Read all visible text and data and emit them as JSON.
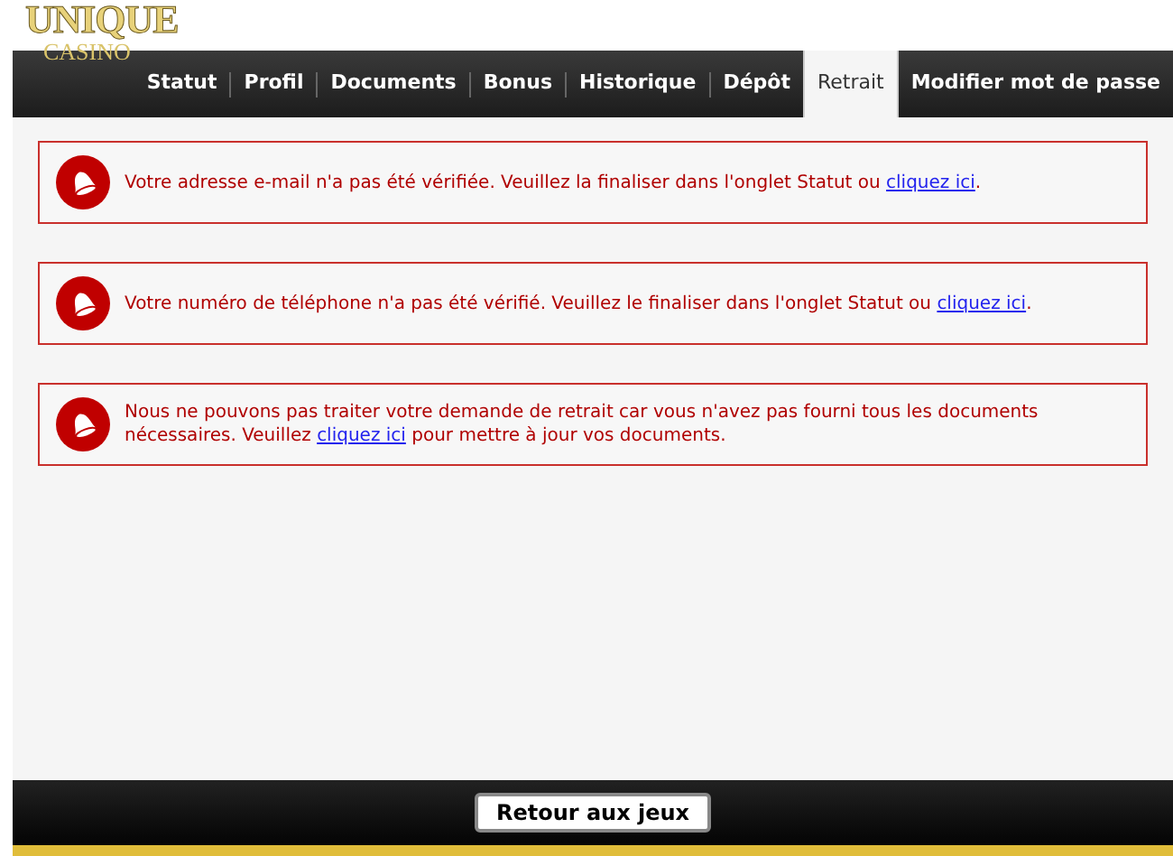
{
  "logo": {
    "top": "UNIQUE",
    "bottom": "CASINO"
  },
  "tabs": [
    {
      "label": "Statut",
      "selected": false
    },
    {
      "label": "Profil",
      "selected": false
    },
    {
      "label": "Documents",
      "selected": false
    },
    {
      "label": "Bonus",
      "selected": false
    },
    {
      "label": "Historique",
      "selected": false
    },
    {
      "label": "Dépôt",
      "selected": false
    },
    {
      "label": "Retrait",
      "selected": true
    },
    {
      "label": "Modifier mot de passe",
      "selected": false
    }
  ],
  "alerts": [
    {
      "before": "Votre adresse e-mail n'a pas été vérifiée. Veuillez la finaliser dans l'onglet Statut ou ",
      "link": "cliquez ici",
      "after": "."
    },
    {
      "before": "Votre numéro de téléphone n'a pas été vérifié. Veuillez le finaliser dans l'onglet Statut ou ",
      "link": "cliquez ici",
      "after": "."
    },
    {
      "before": "Nous ne pouvons pas traiter votre demande de retrait car vous n'avez pas fourni tous les documents nécessaires. Veuillez ",
      "link": "cliquez ici",
      "after": " pour mettre à jour vos documents."
    }
  ],
  "footer_button": "Retour aux jeux"
}
